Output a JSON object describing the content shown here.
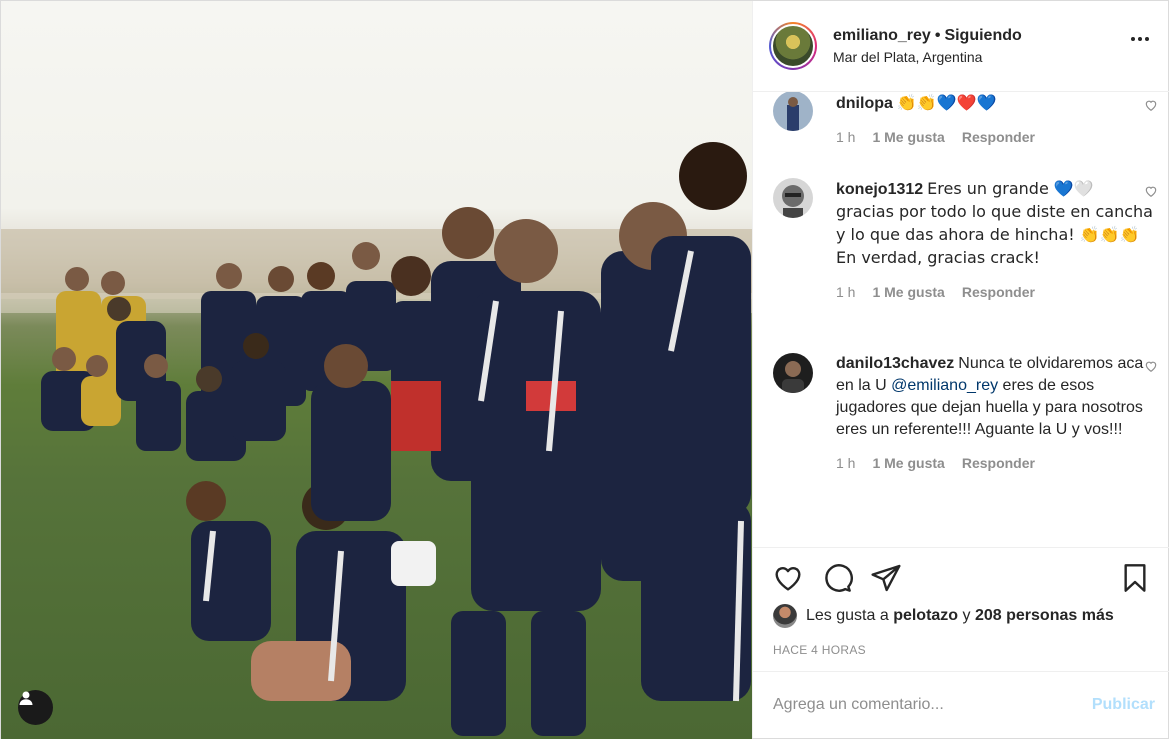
{
  "post": {
    "username": "emiliano_rey",
    "separator": "•",
    "follow_status": "Siguiendo",
    "location": "Mar del Plata, Argentina",
    "more_icon": "more-horizontal-icon"
  },
  "comments": [
    {
      "username": "dnilopa",
      "text": "👏👏💙❤️💙",
      "time": "1 h",
      "likes": "1 Me gusta",
      "reply": "Responder"
    },
    {
      "username": "konejo1312",
      "text": "Eres un grande 💙🤍 gracias por todo lo que diste en cancha y lo que das ahora de hincha! 👏👏👏 En verdad, gracias crack!",
      "time": "1 h",
      "likes": "1 Me gusta",
      "reply": "Responder"
    },
    {
      "username": "danilo13chavez",
      "text_before": "Nunca te olvidaremos aca en la U ",
      "mention": "@emiliano_rey",
      "text_after": " eres de esos jugadores que dejan huella y para nosotros eres un referente!!! Aguante la U y vos!!!",
      "time": "1 h",
      "likes": "1 Me gusta",
      "reply": "Responder"
    }
  ],
  "likes": {
    "prefix": "Les gusta a",
    "user": "pelotazo",
    "connector": "y",
    "others": "208 personas más"
  },
  "timestamp": "HACE 4 HORAS",
  "add_comment": {
    "placeholder": "Agrega un comentario...",
    "publish_label": "Publicar"
  },
  "colors": {
    "publish_disabled": "#b2dffc",
    "mention": "#00376b",
    "secondary_text": "#8e8e8e",
    "border": "#efefef"
  }
}
